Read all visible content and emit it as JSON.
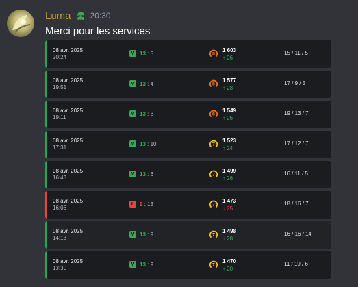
{
  "author": {
    "name": "Luma",
    "timestamp": "20:30",
    "role_icon": "leaf-badge-icon",
    "name_color": "#c8963c"
  },
  "message": {
    "text": "Merci pour les services"
  },
  "matches": [
    {
      "date": "08 avr. 2025",
      "time": "20:24",
      "result": "V",
      "score": "13",
      "opponent_score": "5",
      "rank": "8",
      "elo": "1 603",
      "change": "↑ 26",
      "direction": "up",
      "stats": "15 / 11 / 5"
    },
    {
      "date": "08 avr. 2025",
      "time": "19:51",
      "result": "V",
      "score": "13",
      "opponent_score": "4",
      "rank": "8",
      "elo": "1 577",
      "change": "↑ 28",
      "direction": "up",
      "stats": "17 / 9 / 5"
    },
    {
      "date": "08 avr. 2025",
      "time": "19:11",
      "result": "V",
      "score": "13",
      "opponent_score": "8",
      "rank": "8",
      "elo": "1 549",
      "change": "↑ 26",
      "direction": "up",
      "stats": "19 / 13 / 7"
    },
    {
      "date": "08 avr. 2025",
      "time": "17:31",
      "result": "V",
      "score": "13",
      "opponent_score": "10",
      "rank": "7",
      "elo": "1 523",
      "change": "↑ 24",
      "direction": "up",
      "stats": "17 / 12 / 7"
    },
    {
      "date": "08 avr. 2025",
      "time": "16:43",
      "result": "V",
      "score": "13",
      "opponent_score": "6",
      "rank": "7",
      "elo": "1 499",
      "change": "↑ 26",
      "direction": "up",
      "stats": "16 / 11 / 5"
    },
    {
      "date": "08 avr. 2025",
      "time": "16:06",
      "result": "L",
      "score": "9",
      "opponent_score": "13",
      "rank": "7",
      "elo": "1 473",
      "change": "↓ 25",
      "direction": "down",
      "stats": "18 / 16 / 7"
    },
    {
      "date": "08 avr. 2025",
      "time": "14:13",
      "result": "V",
      "score": "13",
      "opponent_score": "9",
      "rank": "7",
      "elo": "1 498",
      "change": "↑ 28",
      "direction": "up",
      "stats": "16 / 16 / 14"
    },
    {
      "date": "08 avr. 2025",
      "time": "13:30",
      "result": "V",
      "score": "13",
      "opponent_score": "9",
      "rank": "7",
      "elo": "1 470",
      "change": "↑ 20",
      "direction": "up",
      "stats": "11 / 19 / 6"
    }
  ],
  "colors": {
    "win": "#3ba55c",
    "loss": "#ed4245",
    "rank8": "#e8731e",
    "rank7": "#f0c419"
  }
}
